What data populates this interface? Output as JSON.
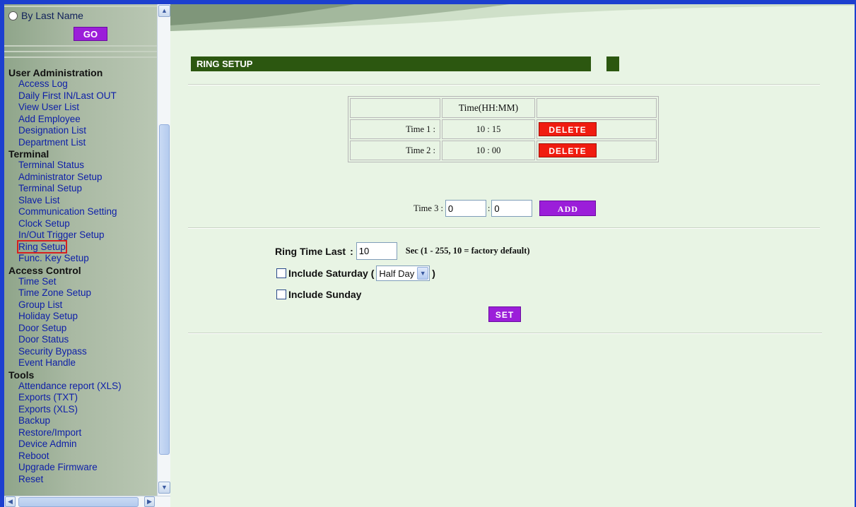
{
  "nav": {
    "search": {
      "radio_label": "By Last Name",
      "go_label": "GO"
    },
    "groups": [
      {
        "title": "User Administration",
        "items": [
          "Access Log",
          "Daily First IN/Last OUT",
          "View User List",
          "Add Employee",
          "Designation List",
          "Department List"
        ]
      },
      {
        "title": "Terminal",
        "items": [
          "Terminal Status",
          "Administrator Setup",
          "Terminal Setup",
          "Slave List",
          "Communication Setting",
          "Clock Setup",
          "In/Out Trigger Setup",
          "Ring Setup",
          "Func. Key Setup"
        ]
      },
      {
        "title": "Access Control",
        "items": [
          "Time Set",
          "Time Zone Setup",
          "Group List",
          "Holiday Setup",
          "Door Setup",
          "Door Status",
          "Security Bypass",
          "Event Handle"
        ]
      },
      {
        "title": "Tools",
        "items": [
          "Attendance report (XLS)",
          "Exports (TXT)",
          "Exports (XLS)",
          "Backup",
          "Restore/Import",
          "Device Admin",
          "Reboot",
          "Upgrade Firmware",
          "Reset"
        ]
      }
    ],
    "active_item": "Ring Setup"
  },
  "section": {
    "title": "RING SETUP"
  },
  "times_table": {
    "header": [
      "",
      "Time(HH:MM)",
      ""
    ],
    "rows": [
      {
        "label": "Time 1 :",
        "time": "10 : 15",
        "action": "DELETE"
      },
      {
        "label": "Time 2 :",
        "time": "10 : 00",
        "action": "DELETE"
      }
    ]
  },
  "add_time": {
    "label": "Time 3 :",
    "hour": "0",
    "separator": ":",
    "minute": "0",
    "button": "ADD"
  },
  "ring": {
    "label": "Ring Time Last",
    "colon": ":",
    "value": "10",
    "hint": "Sec (1 - 255, 10 = factory default)"
  },
  "saturday": {
    "label": "Include Saturday (",
    "closing": ")",
    "option": "Half Day",
    "checked": false
  },
  "sunday": {
    "label": "Include Sunday",
    "checked": false
  },
  "set_button": "SET",
  "colors": {
    "accent_purple": "#9b1ed9",
    "delete_red": "#f01c10",
    "section_green": "#2c5710",
    "content_bg": "#e8f4e4"
  }
}
